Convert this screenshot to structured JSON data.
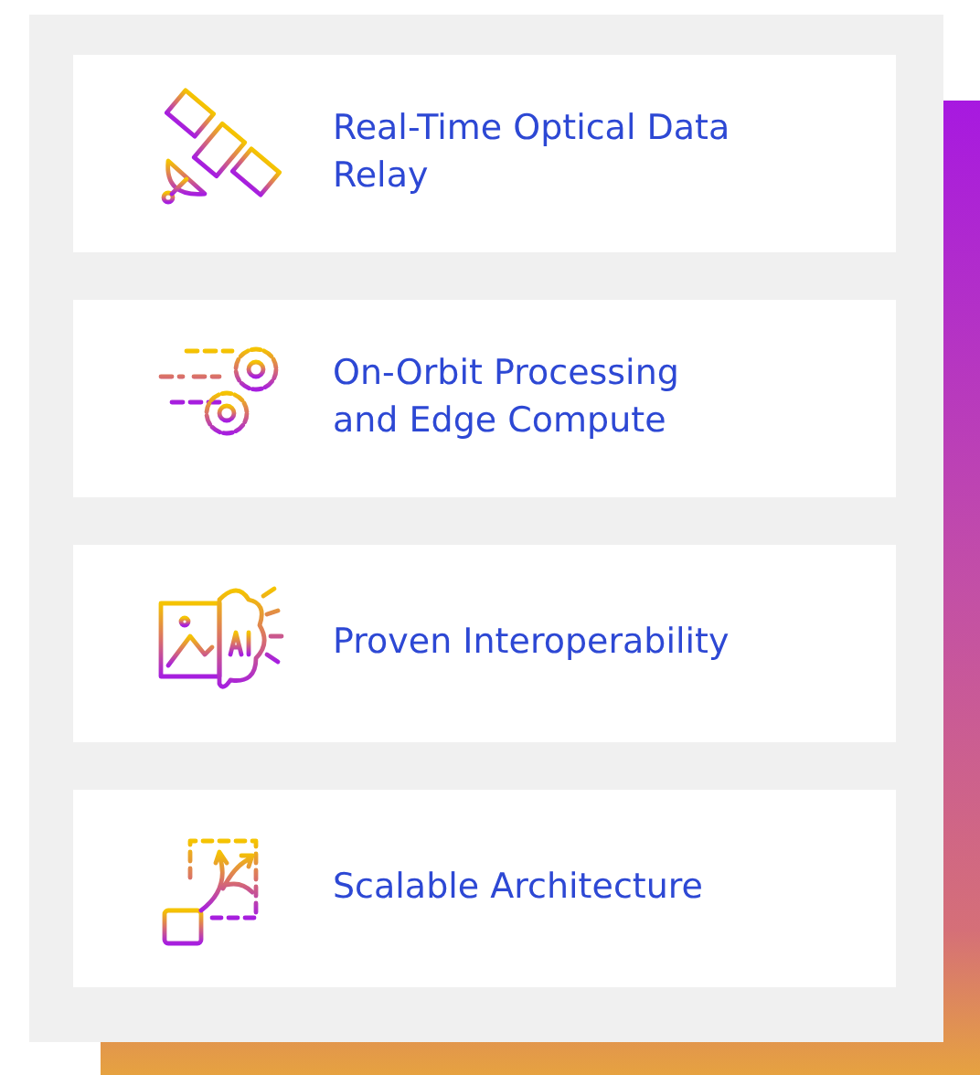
{
  "features": [
    {
      "kind": "satellite",
      "title": "Real-Time Optical Data Relay"
    },
    {
      "kind": "gears",
      "title": "On-Orbit Processing and Edge Compute"
    },
    {
      "kind": "ai",
      "title": "Proven Interoperability"
    },
    {
      "kind": "scale",
      "title": "Scalable Architecture"
    }
  ]
}
